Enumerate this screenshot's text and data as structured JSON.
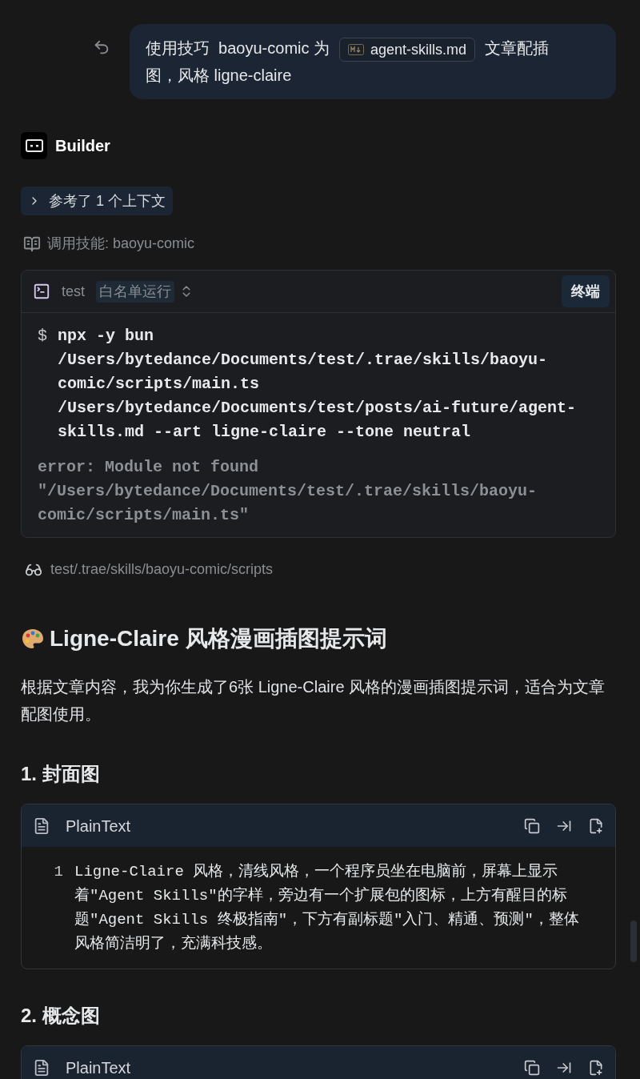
{
  "user_message": {
    "parts": [
      {
        "kind": "text",
        "text": "使用技巧  baoyu-comic 为"
      },
      {
        "kind": "file",
        "text": "agent-skills.md"
      },
      {
        "kind": "text",
        "text": "文章配插"
      },
      {
        "kind": "new_line",
        "text": "图，风格 ligne-claire"
      }
    ]
  },
  "assistant": {
    "name": "Builder"
  },
  "context_toggle": {
    "label": "参考了 1 个上下文",
    "expanded": false
  },
  "skill_call": {
    "label": "调用技能: baoyu-comic"
  },
  "terminal": {
    "cwd": "test",
    "mode": "白名单运行",
    "open_button": "终端",
    "prompt": "$",
    "command": "npx -y bun /Users/bytedance/Documents/test/.trae/skills/baoyu-comic/scripts/main.ts /Users/bytedance/Documents/test/posts/ai-future/agent-skills.md --art ligne-claire --tone neutral",
    "output": "error: Module not found \"/Users/bytedance/Documents/test/.trae/skills/baoyu-comic/scripts/main.ts\""
  },
  "viewed_path": {
    "label": "test/.trae/skills/baoyu-comic/scripts"
  },
  "answer": {
    "title": "Ligne-Claire 风格漫画插图提示词",
    "intro": "根据文章内容，我为你生成了6张 Ligne-Claire 风格的漫画插图提示词，适合为文章配图使用。",
    "sections": [
      {
        "heading": "1. 封面图",
        "code": {
          "language": "PlainText",
          "lines": [
            {
              "number": "1",
              "text": "Ligne-Claire 风格，清线风格，一个程序员坐在电脑前，屏幕上显示着\"Agent Skills\"的字样，旁边有一个扩展包的图标，上方有醒目的标题\"Agent Skills 终极指南\"，下方有副标题\"入门、精通、预测\"，整体风格简洁明了，充满科技感。"
            }
          ]
        }
      },
      {
        "heading": "2. 概念图",
        "code": {
          "language": "PlainText"
        }
      }
    ]
  }
}
